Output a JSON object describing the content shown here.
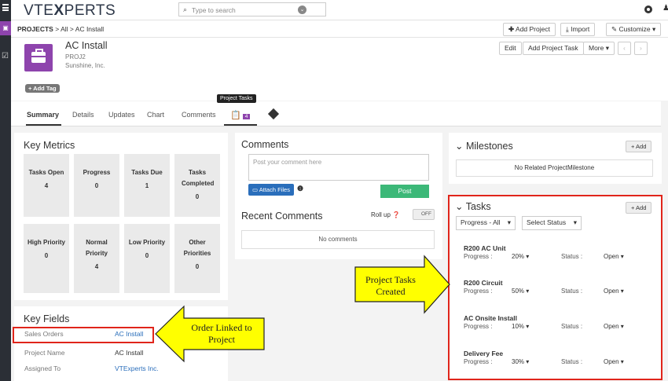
{
  "app": {
    "logo_left": "VTE",
    "logo_x": "X",
    "logo_right": "PERTS",
    "search_placeholder": "Type to search"
  },
  "breadcrumb": {
    "module": "PROJECTS",
    "sep1": ">",
    "filter": "All",
    "sep2": ">",
    "record": "AC Install"
  },
  "toolbar": {
    "add_project": "Add Project",
    "import": "Import",
    "customize": "Customize"
  },
  "record": {
    "title": "AC Install",
    "number": "PROJ2",
    "organization": "Sunshine, Inc.",
    "add_tag": "+ Add Tag",
    "actions": {
      "edit": "Edit",
      "add_task": "Add Project Task",
      "more": "More"
    }
  },
  "tabs": {
    "summary": "Summary",
    "details": "Details",
    "updates": "Updates",
    "chart": "Chart",
    "comments": "Comments",
    "tasks_tooltip": "Project Tasks",
    "tasks_count": "4"
  },
  "key_metrics": {
    "title": "Key Metrics",
    "items": [
      {
        "label": "Tasks Open",
        "value": "4"
      },
      {
        "label": "Progress",
        "value": "0"
      },
      {
        "label": "Tasks Due",
        "value": "1"
      },
      {
        "label": "Tasks Completed",
        "value": "0"
      },
      {
        "label": "High Priority",
        "value": "0"
      },
      {
        "label": "Normal Priority",
        "value": "4"
      },
      {
        "label": "Low Priority",
        "value": "0"
      },
      {
        "label": "Other Priorities",
        "value": "0"
      }
    ]
  },
  "key_fields": {
    "title": "Key Fields",
    "rows": [
      {
        "label": "Sales Orders",
        "value": "AC Install"
      },
      {
        "label": "Project Name",
        "value": "AC Install"
      },
      {
        "label": "Assigned To",
        "value": "VTExperts Inc."
      }
    ]
  },
  "comments": {
    "title": "Comments",
    "placeholder": "Post your comment here",
    "attach": "Attach Files",
    "post": "Post",
    "recent_title": "Recent Comments",
    "rollup": "Roll up",
    "toggle": "OFF",
    "empty": "No comments"
  },
  "milestones": {
    "title": "Milestones",
    "add": "+ Add",
    "empty": "No Related ProjectMilestone"
  },
  "tasks": {
    "title": "Tasks",
    "add": "+ Add",
    "filter_progress": "Progress - All",
    "filter_status": "Select Status",
    "progress_label": "Progress :",
    "status_label": "Status :",
    "items": [
      {
        "name": "R200 AC Unit",
        "progress": "20%",
        "status": "Open"
      },
      {
        "name": "R200 Circuit",
        "progress": "50%",
        "status": "Open"
      },
      {
        "name": "AC Onsite Install",
        "progress": "10%",
        "status": "Open"
      },
      {
        "name": "Delivery Fee",
        "progress": "30%",
        "status": "Open"
      }
    ]
  },
  "annotations": {
    "order_linked_line1": "Order Linked to",
    "order_linked_line2": "Project",
    "tasks_created_line1": "Project Tasks",
    "tasks_created_line2": "Created"
  },
  "colors": {
    "brand_purple": "#8e44ad",
    "highlight_red": "#e0251b",
    "callout_yellow": "#ffff00",
    "post_green": "#3cb878",
    "link_blue": "#2a6ebb"
  }
}
